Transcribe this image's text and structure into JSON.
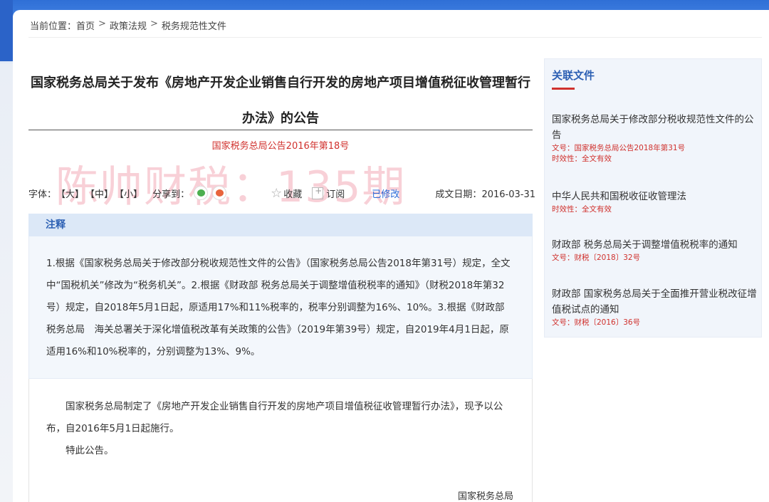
{
  "breadcrumb": {
    "prefix": "当前位置：",
    "home": "首页",
    "policy": "政策法规",
    "current": "税务规范性文件",
    "sep": ">"
  },
  "article": {
    "title": "国家税务总局关于发布《房地产开发企业销售自行开发的房地产项目增值税征收管理暂行办法》的公告",
    "doc_number": "国家税务总局公告2016年第18号"
  },
  "watermark": "陈帅财税：135期",
  "toolbar": {
    "font_label": "字体：",
    "font_large": "【大】",
    "font_medium": "【中】",
    "font_small": "【小】",
    "share_label": "分享到：",
    "favorite": "收藏",
    "subscribe": "订阅",
    "modified_prefix": "已",
    "modified_link": "修改",
    "date_label": "成文日期：",
    "date": "2016-03-31"
  },
  "note": {
    "heading": "注释",
    "text": "1.根据《国家税务总局关于修改部分税收规范性文件的公告》（国家税务总局公告2018年第31号）规定，全文中“国税机关”修改为“税务机关”。2.根据《财政部 税务总局关于调整增值税税率的通知》（财税2018年第32号）规定，自2018年5月1日起，原适用17%和11%税率的，税率分别调整为16%、10%。3.根据《财政部　税务总局　海关总署关于深化增值税改革有关政策的公告》（2019年第39号）规定，自2019年4月1日起，原适用16%和10%税率的，分别调整为13%、9%。"
  },
  "content": {
    "para1": "国家税务总局制定了《房地产开发企业销售自行开发的房地产项目增值税征收管理暂行办法》，现予以公布，自2016年5月1日起施行。",
    "para2": "特此公告。",
    "signature": "国家税务总局"
  },
  "sidebar": {
    "heading": "关联文件",
    "items": [
      {
        "title": "国家税务总局关于修改部分税收规范性文件的公告",
        "doc": "文号：国家税务总局公告2018年第31号",
        "validity": "时效性：全文有效"
      },
      {
        "title": "中华人民共和国税收征收管理法",
        "validity": "时效性：全文有效"
      },
      {
        "title": "财政部 税务总局关于调整增值税税率的通知",
        "doc": "文号：财税〔2018〕32号"
      },
      {
        "title": "财政部 国家税务总局关于全面推开营业税改征增值税试点的通知",
        "doc": "文号：财税〔2016〕36号"
      }
    ]
  },
  "colors": {
    "accent_blue": "#2b5fb3",
    "accent_red": "#d0312d",
    "note_bg": "#dce8f7"
  }
}
